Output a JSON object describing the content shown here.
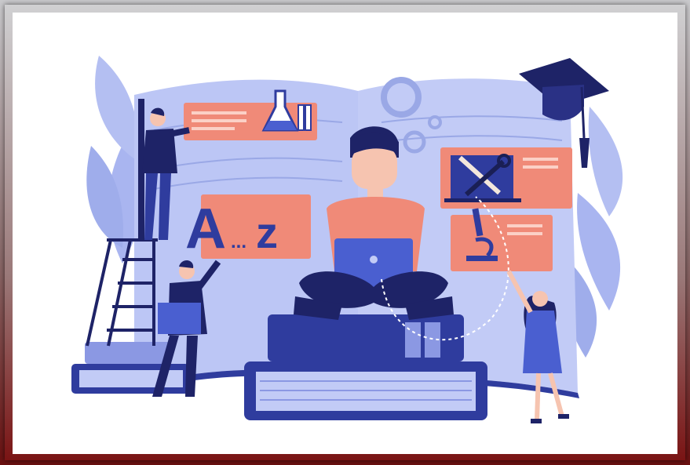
{
  "illustration": {
    "big_letter": "A",
    "ellipsis": "...",
    "small_letter": "z"
  },
  "colors": {
    "book": "#b9c3f4",
    "book_dark": "#2f3c9e",
    "accent": "#f08a78",
    "navy": "#1e2367",
    "leaf": "#9aa8ee",
    "skin": "#f6c4b0"
  }
}
